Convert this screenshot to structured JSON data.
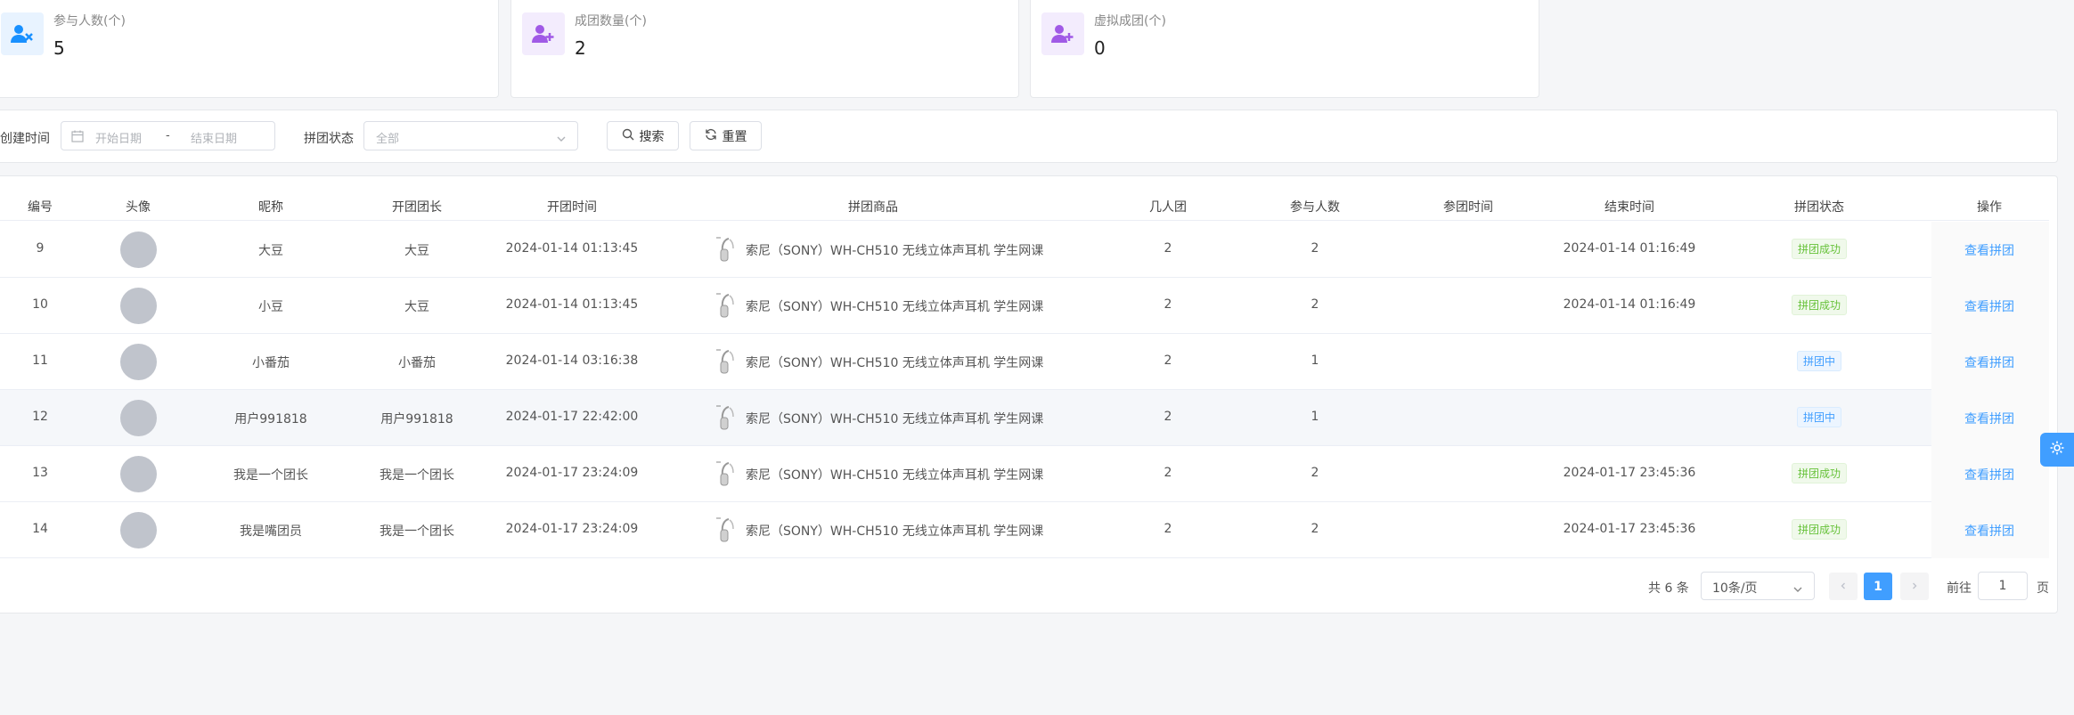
{
  "stats": [
    {
      "label": "参与人数(个)",
      "value": "5",
      "icon": "user-x-icon",
      "color": "#1890ff"
    },
    {
      "label": "成团数量(个)",
      "value": "2",
      "icon": "user-add-icon",
      "color": "#a05ae6"
    },
    {
      "label": "虚拟成团(个)",
      "value": "0",
      "icon": "user-add-icon",
      "color": "#a05ae6"
    }
  ],
  "filter": {
    "created_label": "创建时间",
    "start_placeholder": "开始日期",
    "range_sep": "-",
    "end_placeholder": "结束日期",
    "status_label": "拼团状态",
    "status_value": "全部",
    "search_label": "搜索",
    "reset_label": "重置"
  },
  "table": {
    "headers": [
      "编号",
      "头像",
      "昵称",
      "开团团长",
      "开团时间",
      "拼团商品",
      "几人团",
      "参与人数",
      "参团时间",
      "结束时间",
      "拼团状态",
      "操作"
    ],
    "action_label": "查看拼团",
    "rows": [
      {
        "id": "9",
        "nickname": "大豆",
        "leader": "大豆",
        "open_time": "2024-01-14 01:13:45",
        "goods": "索尼（SONY）WH-CH510 无线立体声耳机 学生网课",
        "group_size": "2",
        "participants": "2",
        "join_time": "",
        "end_time": "2024-01-14 01:16:49",
        "status": "拼团成功",
        "status_type": "success"
      },
      {
        "id": "10",
        "nickname": "小豆",
        "leader": "大豆",
        "open_time": "2024-01-14 01:13:45",
        "goods": "索尼（SONY）WH-CH510 无线立体声耳机 学生网课",
        "group_size": "2",
        "participants": "2",
        "join_time": "",
        "end_time": "2024-01-14 01:16:49",
        "status": "拼团成功",
        "status_type": "success"
      },
      {
        "id": "11",
        "nickname": "小番茄",
        "leader": "小番茄",
        "open_time": "2024-01-14 03:16:38",
        "goods": "索尼（SONY）WH-CH510 无线立体声耳机 学生网课",
        "group_size": "2",
        "participants": "1",
        "join_time": "",
        "end_time": "",
        "status": "拼团中",
        "status_type": "progress"
      },
      {
        "id": "12",
        "nickname": "用户991818",
        "leader": "用户991818",
        "open_time": "2024-01-17 22:42:00",
        "goods": "索尼（SONY）WH-CH510 无线立体声耳机 学生网课",
        "group_size": "2",
        "participants": "1",
        "join_time": "",
        "end_time": "",
        "status": "拼团中",
        "status_type": "progress"
      },
      {
        "id": "13",
        "nickname": "我是一个团长",
        "leader": "我是一个团长",
        "open_time": "2024-01-17 23:24:09",
        "goods": "索尼（SONY）WH-CH510 无线立体声耳机 学生网课",
        "group_size": "2",
        "participants": "2",
        "join_time": "",
        "end_time": "2024-01-17 23:45:36",
        "status": "拼团成功",
        "status_type": "success"
      },
      {
        "id": "14",
        "nickname": "我是嘴团员",
        "leader": "我是一个团长",
        "open_time": "2024-01-17 23:24:09",
        "goods": "索尼（SONY）WH-CH510 无线立体声耳机 学生网课",
        "group_size": "2",
        "participants": "2",
        "join_time": "",
        "end_time": "2024-01-17 23:45:36",
        "status": "拼团成功",
        "status_type": "success"
      }
    ]
  },
  "pagination": {
    "total": "共 6 条",
    "page_size": "10条/页",
    "current": "1",
    "goto_label": "前往",
    "goto_value": "1",
    "page_suffix": "页"
  }
}
